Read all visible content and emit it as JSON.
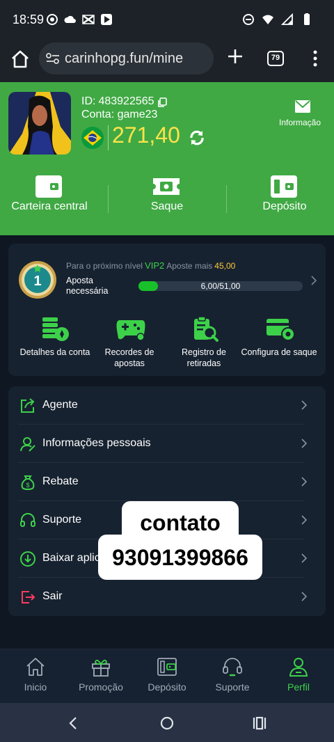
{
  "status_bar": {
    "time": "18:59"
  },
  "browser": {
    "url": "carinhopg.fun/mine",
    "tab_count": "79"
  },
  "profile": {
    "id_label": "ID:",
    "id_value": "483922565",
    "account": "Conta: game23",
    "balance": "271,40",
    "info_label": "Informação"
  },
  "header_actions": [
    {
      "label": "Carteira central",
      "icon": "wallet-icon"
    },
    {
      "label": "Saque",
      "icon": "withdraw-ticket-icon"
    },
    {
      "label": "Depósito",
      "icon": "deposit-wallet-icon"
    }
  ],
  "vip": {
    "level": "1",
    "next_prefix": "Para o próximo nível",
    "next_level": "VIP2",
    "bet_more": "Aposte mais",
    "bet_more_amount": "45,00",
    "required_label": "Aposta necessária",
    "progress_text": "6,00/51,00",
    "progress_fraction": 0.118
  },
  "quick_actions": [
    {
      "label": "Detalhes da conta",
      "icon": "account-details-icon"
    },
    {
      "label": "Recordes de apostas",
      "icon": "gamepad-icon"
    },
    {
      "label": "Registro de retiradas",
      "icon": "withdraw-record-icon"
    },
    {
      "label": "Configura de saque",
      "icon": "withdraw-settings-icon"
    }
  ],
  "menu": [
    {
      "label": "Agente",
      "icon": "share-icon"
    },
    {
      "label": "Informações pessoais",
      "icon": "user-icon"
    },
    {
      "label": "Rebate",
      "icon": "money-bag-icon"
    },
    {
      "label": "Suporte",
      "icon": "headset-icon"
    },
    {
      "label": "Baixar aplic",
      "icon": "download-icon"
    },
    {
      "label": "Sair",
      "icon": "logout-icon"
    }
  ],
  "overlay": {
    "line1": "contato",
    "line2": "93091399866"
  },
  "bottom_nav": [
    {
      "label": "Inicio",
      "icon": "home-icon"
    },
    {
      "label": "Promoção",
      "icon": "gift-icon"
    },
    {
      "label": "Depósito",
      "icon": "deposit-icon"
    },
    {
      "label": "Suporte",
      "icon": "support-icon"
    },
    {
      "label": "Perfil",
      "icon": "profile-icon",
      "active": true
    }
  ],
  "colors": {
    "accent_green": "#40a944",
    "balance_yellow": "#ffe34a",
    "vip_green": "#3dd14a",
    "card_bg": "#172230"
  }
}
